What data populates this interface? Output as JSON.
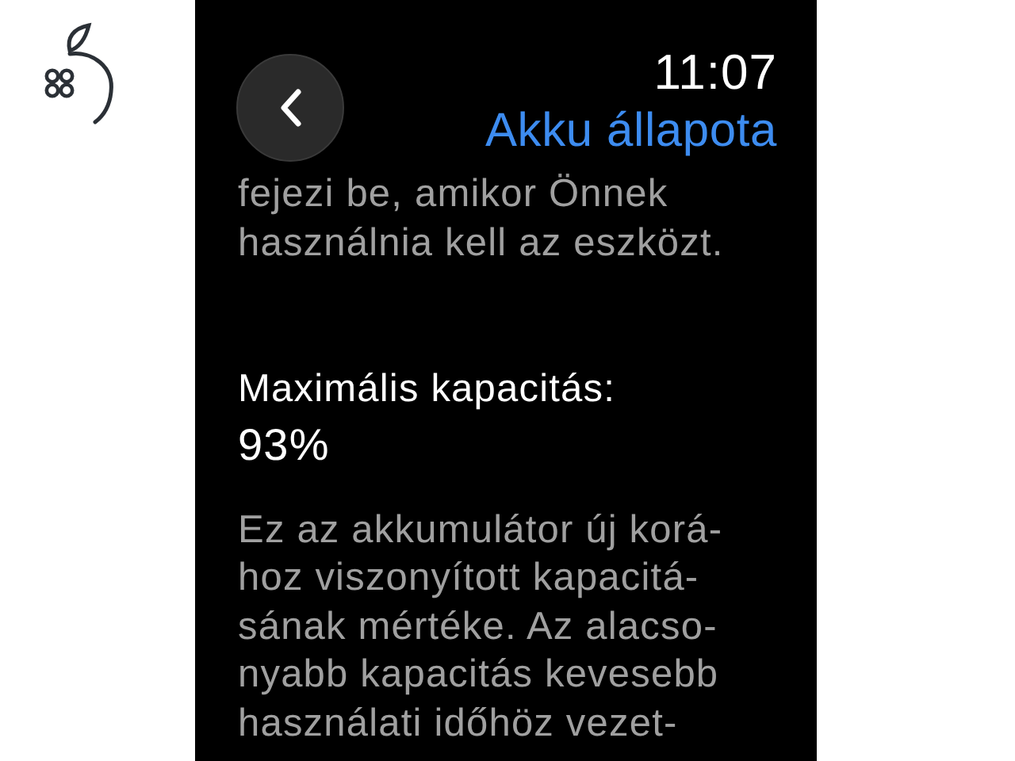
{
  "status": {
    "time": "11:07"
  },
  "nav": {
    "title": "Akku állapota"
  },
  "sections": [
    {
      "kind": "note",
      "lines": [
        "fejezi be, amikor Önnek",
        "használnia kell az eszközt."
      ]
    },
    {
      "kind": "heading",
      "lines": [
        "Maximális kapacitás:"
      ]
    },
    {
      "kind": "value",
      "lines": [
        "93%"
      ]
    },
    {
      "kind": "note",
      "lines": [
        "Ez az akkumulátor új korá-",
        "hoz viszonyított kapacitá-",
        "sának mértéke. Az alacso-",
        "nyabb kapacitás kevesebb",
        "használati időhöz vezet-"
      ]
    }
  ]
}
